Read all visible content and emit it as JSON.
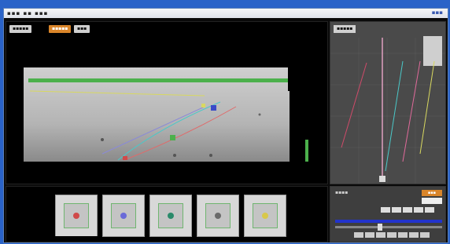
{
  "titlebar": {
    "menu": "▪▪▪ ▪▪ ▪▪▪",
    "ctrl": "▪▪▪"
  },
  "viewer": {
    "btn_view": "▪▪▪▪▪",
    "btn_active": "▪▪▪▪▪",
    "btn_mode": "▪▪▪"
  },
  "plot": {
    "btn": "▪▪▪▪▪"
  },
  "thumbnails": [
    {
      "dot_color": "#d04a4a"
    },
    {
      "dot_color": "#6a6ad8"
    },
    {
      "dot_color": "#2a8a6a"
    },
    {
      "dot_color": "#6a6a6a"
    },
    {
      "dot_color": "#d8c84a"
    }
  ],
  "controls": {
    "label": "▪▪▪▪",
    "orange_btn": "▪▪▪"
  },
  "colors": {
    "accent": "#d9852a",
    "green": "#4cb04c",
    "blue": "#2233cc",
    "pink": "#e06a6a",
    "cyan": "#4ac8c8"
  }
}
